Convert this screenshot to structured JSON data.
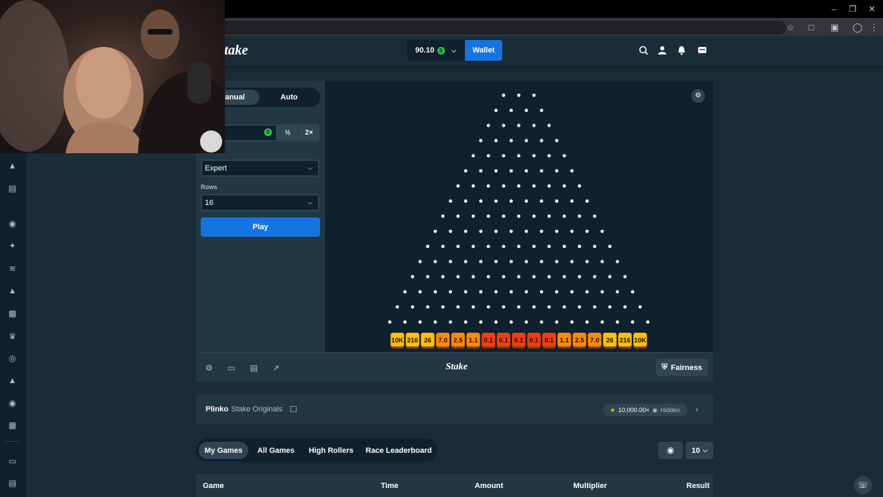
{
  "balance": {
    "amount": "90.10",
    "currency_symbol": "S"
  },
  "header": {
    "wallet_label": "Wallet",
    "logo": "Stake"
  },
  "game_controls": {
    "mode_tabs": [
      "Manual",
      "Auto"
    ],
    "bet_currency": "S",
    "half_label": "½",
    "double_label": "2×",
    "risk_value": "Expert",
    "rows_label": "Rows",
    "rows_value": "16",
    "play_label": "Play"
  },
  "plinko": {
    "peg_rows": 16,
    "multipliers": [
      "10K",
      "216",
      "26",
      "7.0",
      "2.5",
      "1.1",
      "0.1",
      "0.1",
      "0.1",
      "0.1",
      "0.1",
      "1.1",
      "2.5",
      "7.0",
      "26",
      "216",
      "10K"
    ],
    "colors": {
      "high": "#ffc000",
      "mid": "#ff8a00",
      "low": "#f03d12"
    }
  },
  "footer": {
    "logo": "Stake",
    "fairness_label": "Fairness"
  },
  "game_info": {
    "name": "Plinko",
    "provider": "Stake Originals",
    "max_win": "10,000.00×",
    "hidden_label": "Hidden"
  },
  "bets_tabs": [
    "My Games",
    "All Games",
    "High Rollers",
    "Race Leaderboard"
  ],
  "page_size": "10",
  "table_headers": [
    "Game",
    "Time",
    "Amount",
    "Multiplier",
    "Result"
  ]
}
